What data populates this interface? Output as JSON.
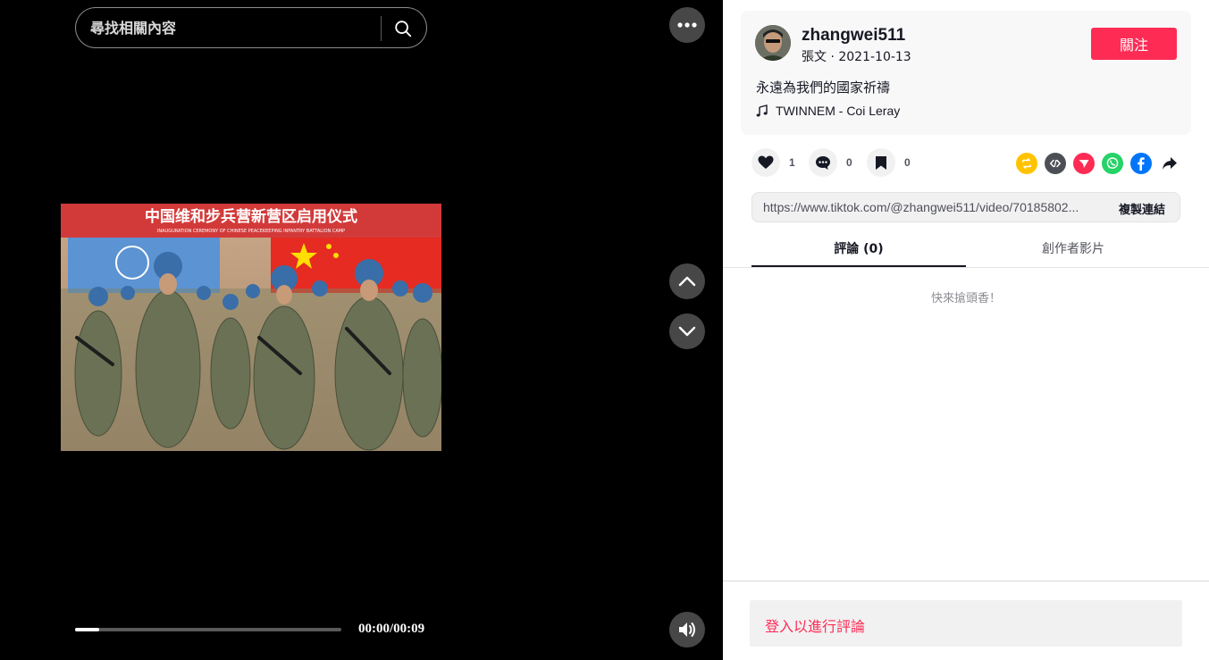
{
  "search": {
    "placeholder": "尋找相關內容"
  },
  "player": {
    "time": "00:00/00:09",
    "progress": 0.09,
    "banner_text": "中国维和步兵营新营区启用仪式",
    "banner_subtext": "INAUGURATION CEREMONY OF CHINESE PEACEKEEPING INFANTRY BATTALION CAMP"
  },
  "author": {
    "username": "zhangwei511",
    "subline": "張文 · 2021-10-13",
    "follow_label": "關注"
  },
  "post": {
    "caption": "永遠為我們的國家祈禱",
    "music": "TWINNEM - Coi Leray"
  },
  "actions": {
    "likes": "1",
    "comments": "0",
    "saves": "0"
  },
  "share": {
    "icons": [
      "repost-icon",
      "embed-icon",
      "send-icon",
      "whatsapp-icon",
      "facebook-icon",
      "share-arrow-icon"
    ],
    "colors": {
      "repost": "#ffc300",
      "embed": "#4d4f56",
      "send": "#fe2c55",
      "whatsapp": "#25d366",
      "facebook": "#0075fa"
    }
  },
  "link": {
    "url": "https://www.tiktok.com/@zhangwei511/video/70185802...",
    "copy_label": "複製連結"
  },
  "tabs": [
    {
      "label": "評論 (0)"
    },
    {
      "label": "創作者影片"
    }
  ],
  "comments": {
    "empty_text": "快來搶頭香！",
    "login_prompt": "登入以進行評論"
  },
  "colors": {
    "accent": "#fe2c55",
    "player_bg": "#000000"
  }
}
